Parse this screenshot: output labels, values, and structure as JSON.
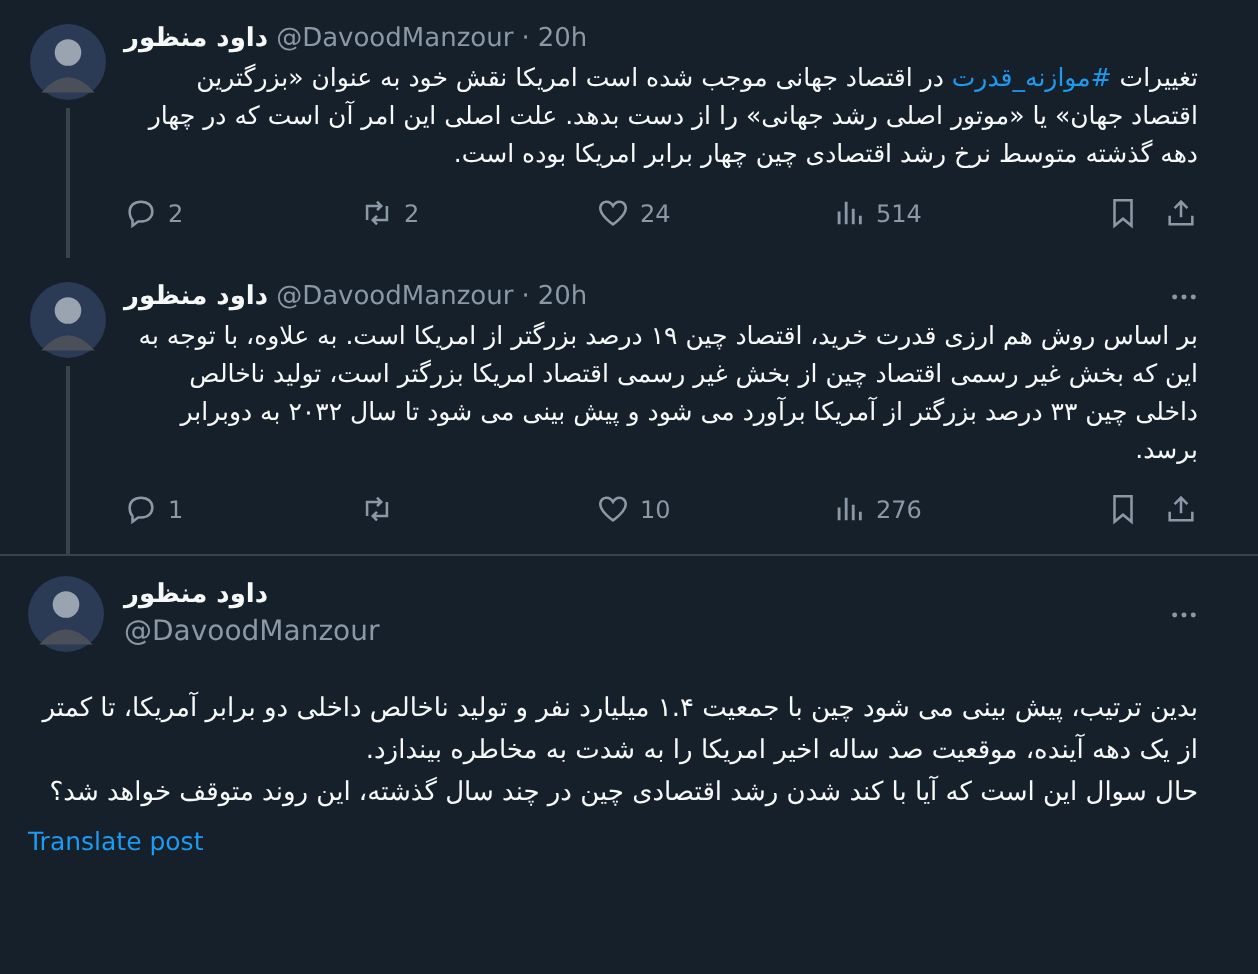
{
  "tweets": [
    {
      "kind": "thread",
      "name": "داود منظور",
      "handle": "@DavoodManzour",
      "separator": "·",
      "time": "20h",
      "more_menu": false,
      "body": [
        {
          "kind": "text",
          "text": "تغییرات "
        },
        {
          "kind": "hashtag",
          "text": "#موازنه_قدرت"
        },
        {
          "kind": "text",
          "text": " در اقتصاد جهانی موجب شده است امریکا نقش خود به عنوان «بزرگترین اقتصاد جهان» یا «موتور اصلی رشد جهانی» را از دست بدهد. علت اصلی این امر آن است که در چهار دهه گذشته متوسط نرخ رشد اقتصادی چین چهار برابر امریکا بوده است."
        }
      ],
      "stats": {
        "replies": "2",
        "reposts": "2",
        "likes": "24",
        "views": "514"
      }
    },
    {
      "kind": "thread",
      "name": "داود منظور",
      "handle": "@DavoodManzour",
      "separator": "·",
      "time": "20h",
      "more_menu": true,
      "body": [
        {
          "kind": "text",
          "text": "بر اساس روش هم ارزی قدرت خرید، اقتصاد چین ۱۹ درصد بزرگتر از امریکا است. به علاوه، با توجه به این که بخش غیر رسمی اقتصاد چین از بخش غیر رسمی اقتصاد امریکا بزرگتر است، تولید ناخالص داخلی چین ۳۳ درصد بزرگتر از آمریکا برآورد می شود و پیش بینی می شود تا سال ۲۰۳۲ به دوبرابر برسد."
        }
      ],
      "stats": {
        "replies": "1",
        "likes": "10",
        "views": "276"
      }
    },
    {
      "kind": "focus",
      "name": "داود منظور",
      "handle": "@DavoodManzour",
      "more_menu": true,
      "paragraphs": [
        "بدین ترتیب، پیش بینی می شود چین با جمعیت ۱.۴ میلیارد نفر و تولید ناخالص داخلی دو برابر آمریکا، تا کمتر از یک دهه آینده، موقعیت صد ساله اخیر امریکا را به شدت به مخاطره بیندازد.",
        "حال سوال این است که آیا با کند شدن رشد اقتصادی چین در چند سال گذشته، این روند متوقف خواهد شد؟"
      ],
      "translate": "Translate post"
    }
  ]
}
